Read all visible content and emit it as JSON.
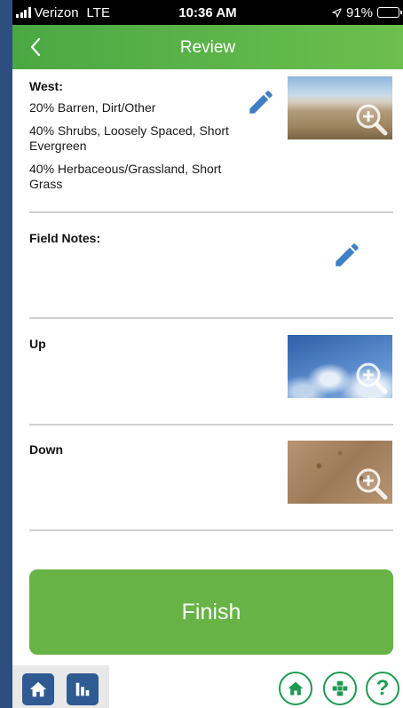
{
  "status_bar": {
    "carrier": "Verizon",
    "network": "LTE",
    "time": "10:36 AM",
    "battery": "91%",
    "battery_level": 0.91
  },
  "nav": {
    "title": "Review",
    "back_icon": "chevron-left-icon"
  },
  "west": {
    "heading": "West:",
    "lines": [
      "20% Barren, Dirt/Other",
      "40% Shrubs, Loosely Spaced, Short Evergreen",
      "40% Herbaceous/Grassland, Short Grass"
    ]
  },
  "field_notes": {
    "heading": "Field Notes:"
  },
  "up": {
    "heading": "Up"
  },
  "down": {
    "heading": "Down"
  },
  "finish": {
    "label": "Finish"
  },
  "colors": {
    "nav_green": "#5bb148",
    "finish_green": "#67b346",
    "edit_blue": "#3f7fc6",
    "tab_blue": "#2f5a92",
    "round_green": "#1f9a52"
  }
}
